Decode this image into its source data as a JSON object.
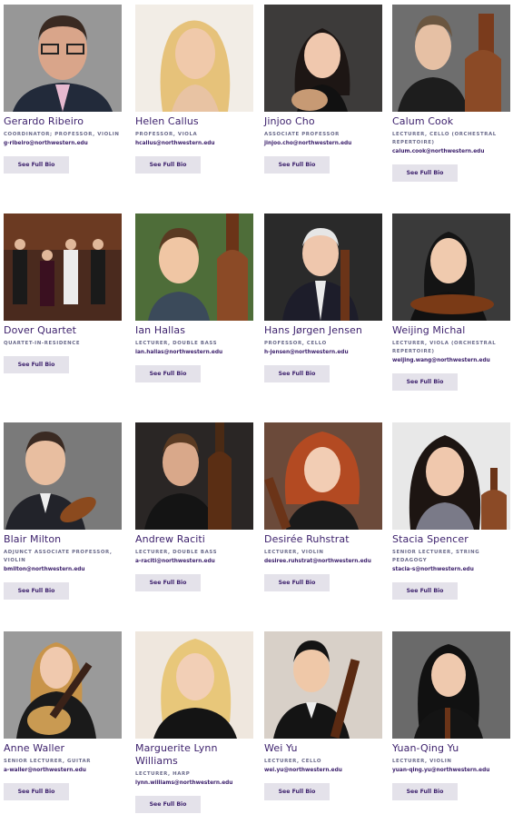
{
  "faculty": [
    {
      "name": "Gerardo Ribeiro",
      "title": "COORDINATOR; PROFESSOR, VIOLIN",
      "email": "g-ribeiro@northwestern.edu",
      "button": "See Full Bio",
      "photo": "portrait-icon"
    },
    {
      "name": "Helen Callus",
      "title": "PROFESSOR, VIOLA",
      "email": "hcallus@northwestern.edu",
      "button": "See Full Bio",
      "photo": "portrait-icon"
    },
    {
      "name": "Jinjoo Cho",
      "title": "ASSOCIATE PROFESSOR",
      "email": "jinjoo.cho@northwestern.edu",
      "button": "See Full Bio",
      "photo": "portrait-icon"
    },
    {
      "name": "Calum Cook",
      "title": "LECTURER, CELLO (ORCHESTRAL REPERTOIRE)",
      "email": "calum.cook@northwestern.edu",
      "button": "See Full Bio",
      "photo": "portrait-icon"
    },
    {
      "name": "Dover Quartet",
      "title": "QUARTET-IN-RESIDENCE",
      "email": "",
      "button": "See Full Bio",
      "photo": "group-portrait-icon"
    },
    {
      "name": "Ian Hallas",
      "title": "LECTURER, DOUBLE BASS",
      "email": "ian.hallas@northwestern.edu",
      "button": "See Full Bio",
      "photo": "portrait-icon"
    },
    {
      "name": "Hans Jørgen Jensen",
      "title": "PROFESSOR, CELLO",
      "email": "h-jensen@northwestern.edu",
      "button": "See Full Bio",
      "photo": "portrait-icon"
    },
    {
      "name": "Weijing Michal",
      "title": "LECTURER, VIOLA (ORCHESTRAL REPERTOIRE)",
      "email": "weijing.wang@northwestern.edu",
      "button": "See Full Bio",
      "photo": "portrait-icon"
    },
    {
      "name": "Blair Milton",
      "title": "ADJUNCT ASSOCIATE PROFESSOR, VIOLIN",
      "email": "bmilton@northwestern.edu",
      "button": "See Full Bio",
      "photo": "portrait-icon"
    },
    {
      "name": "Andrew Raciti",
      "title": "LECTURER, DOUBLE BASS",
      "email": "a-raciti@northwestern.edu",
      "button": "See Full Bio",
      "photo": "portrait-icon"
    },
    {
      "name": "Desirée Ruhstrat",
      "title": "LECTURER, VIOLIN",
      "email": "desiree.ruhstrat@northwestern.edu",
      "button": "See Full Bio",
      "photo": "portrait-icon"
    },
    {
      "name": "Stacia Spencer",
      "title": "SENIOR LECTURER, STRING PEDAGOGY",
      "email": "stacia-s@northwestern.edu",
      "button": "See Full Bio",
      "photo": "portrait-icon"
    },
    {
      "name": "Anne Waller",
      "title": "SENIOR LECTURER, GUITAR",
      "email": "a-waller@northwestern.edu",
      "button": "See Full Bio",
      "photo": "portrait-icon"
    },
    {
      "name": "Marguerite Lynn Williams",
      "title": "LECTURER, HARP",
      "email": "lynn.williams@northwestern.edu",
      "button": "See Full Bio",
      "photo": "portrait-icon"
    },
    {
      "name": "Wei Yu",
      "title": "LECTURER, CELLO",
      "email": "wei.yu@northwestern.edu",
      "button": "See Full Bio",
      "photo": "portrait-icon"
    },
    {
      "name": "Yuan-Qing Yu",
      "title": "LECTURER, VIOLIN",
      "email": "yuan-qing.yu@northwestern.edu",
      "button": "See Full Bio",
      "photo": "portrait-icon"
    }
  ],
  "colors": {
    "name": "#3b1f6b",
    "title": "#6a6a8a",
    "button_bg": "#e4e2ea"
  }
}
